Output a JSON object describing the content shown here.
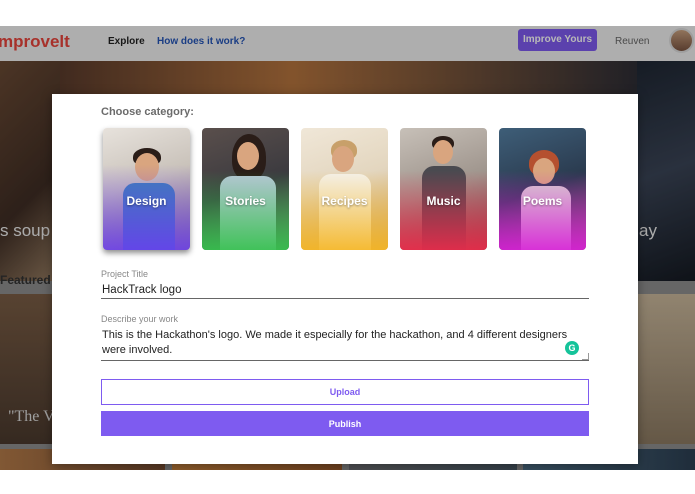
{
  "app": {
    "logo": "mprovelt",
    "nav": {
      "explore": "Explore",
      "how_it_works": "How does it work?"
    },
    "improve_button": "Improve Yours",
    "username": "Reuven",
    "hero_left_text": "s soup",
    "hero_right_text": "ay",
    "featured_label": "Featured",
    "card_left_text": "\"The V"
  },
  "modal": {
    "category_heading": "Choose category:",
    "categories": [
      {
        "label": "Design",
        "tint": "#6a3cf0"
      },
      {
        "label": "Stories",
        "tint": "#34c24c"
      },
      {
        "label": "Recipes",
        "tint": "#f5b520"
      },
      {
        "label": "Music",
        "tint": "#ee2a4a"
      },
      {
        "label": "Poems",
        "tint": "#d81fd8"
      }
    ],
    "project_title_label": "Project Title",
    "project_title_value": "HackTrack logo",
    "description_label": "Describe your work",
    "description_value": "This is the Hackathon's logo. We made it especially for the hackathon, and 4 different designers were involved.",
    "grammarly_glyph": "G",
    "upload_label": "Upload",
    "publish_label": "Publish"
  },
  "colors": {
    "accent": "#7e5bf0",
    "brand": "#e8453c",
    "grammarly": "#15c39a"
  }
}
